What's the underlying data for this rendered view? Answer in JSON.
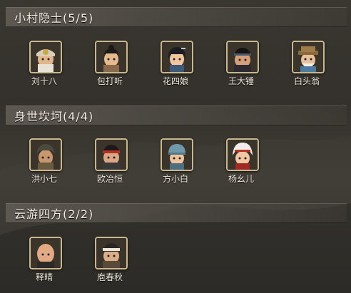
{
  "groups": [
    {
      "title": "小村隐士(5/5)",
      "members": [
        {
          "name": "刘十八",
          "icon": "old-man-headband-portrait-icon"
        },
        {
          "name": "包打听",
          "icon": "man-topknot-portrait-icon"
        },
        {
          "name": "花四娘",
          "icon": "woman-hairpin-portrait-icon"
        },
        {
          "name": "王大锤",
          "icon": "man-headband-portrait-icon"
        },
        {
          "name": "白头翁",
          "icon": "old-man-hat-portrait-icon"
        }
      ]
    },
    {
      "title": "身世坎坷(4/4)",
      "members": [
        {
          "name": "洪小七",
          "icon": "beggar-boy-portrait-icon"
        },
        {
          "name": "欧冶恒",
          "icon": "smith-red-headband-portrait-icon"
        },
        {
          "name": "方小白",
          "icon": "boy-blue-cap-portrait-icon"
        },
        {
          "name": "杨幺儿",
          "icon": "girl-white-bonnet-portrait-icon"
        }
      ]
    },
    {
      "title": "云游四方(2/2)",
      "members": [
        {
          "name": "释晴",
          "icon": "monk-portrait-icon"
        },
        {
          "name": "庖春秋",
          "icon": "cook-headband-portrait-icon"
        }
      ]
    }
  ]
}
